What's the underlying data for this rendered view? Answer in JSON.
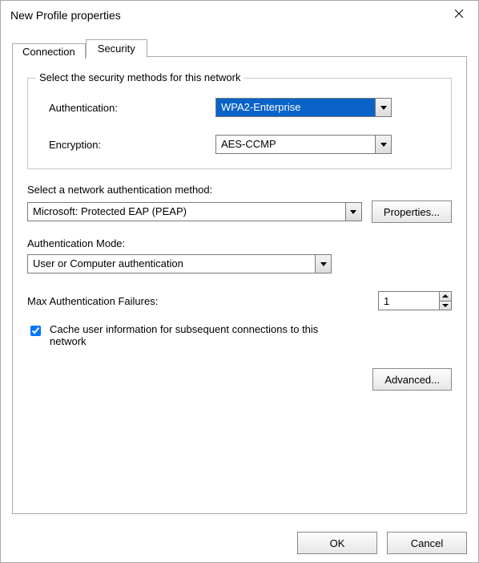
{
  "window": {
    "title": "New Profile properties"
  },
  "tabs": [
    {
      "label": "Connection",
      "active": false
    },
    {
      "label": "Security",
      "active": true
    }
  ],
  "group": {
    "legend": "Select the security methods for this network",
    "auth_label": "Authentication:",
    "auth_value": "WPA2-Enterprise",
    "enc_label": "Encryption:",
    "enc_value": "AES-CCMP"
  },
  "netauth": {
    "label": "Select a network authentication method:",
    "value": "Microsoft: Protected EAP (PEAP)",
    "props_btn": "Properties..."
  },
  "authmode": {
    "label": "Authentication Mode:",
    "value": "User or Computer authentication"
  },
  "maxfail": {
    "label": "Max Authentication Failures:",
    "value": "1"
  },
  "cache": {
    "checked": true,
    "label": "Cache user information for subsequent connections to this network"
  },
  "advanced_btn": "Advanced...",
  "dlg": {
    "ok": "OK",
    "cancel": "Cancel"
  }
}
